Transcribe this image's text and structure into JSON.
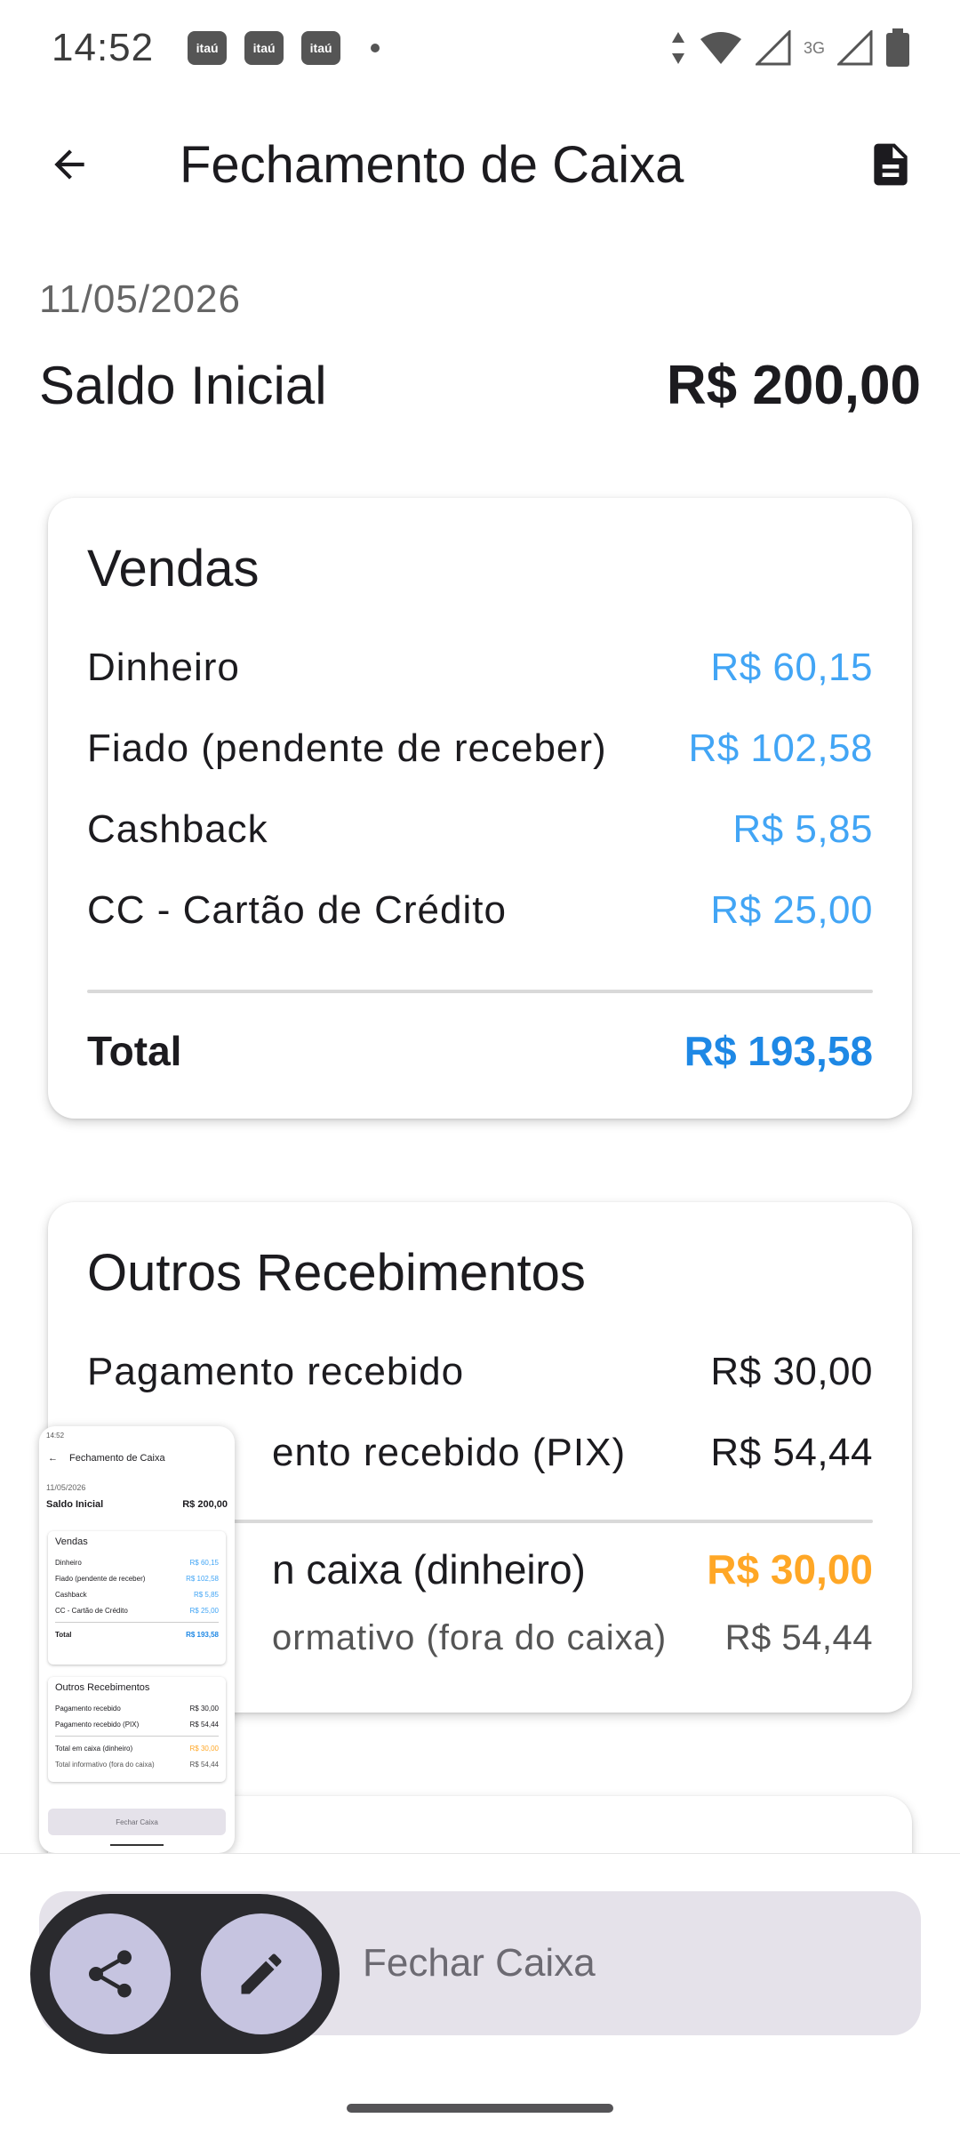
{
  "status_bar": {
    "time": "14:52",
    "notifications": [
      "itaú",
      "itaú",
      "itaú"
    ],
    "network_label": "3G",
    "icons": [
      "itau-app-icon",
      "dot-icon",
      "data-arrows-icon",
      "wifi-icon",
      "signal-icon",
      "battery-icon"
    ]
  },
  "app_bar": {
    "title": "Fechamento de Caixa",
    "back_icon": "arrow-left-icon",
    "action_icon": "document-icon"
  },
  "header": {
    "date": "11/05/2026",
    "saldo_label": "Saldo Inicial",
    "saldo_value": "R$ 200,00"
  },
  "vendas": {
    "title": "Vendas",
    "rows": [
      {
        "label": "Dinheiro",
        "value": "R$ 60,15"
      },
      {
        "label": "Fiado (pendente de receber)",
        "value": "R$ 102,58"
      },
      {
        "label": "Cashback",
        "value": "R$ 5,85"
      },
      {
        "label": "CC - Cartão de Crédito",
        "value": "R$ 25,00"
      }
    ],
    "total_label": "Total",
    "total_value": "R$ 193,58"
  },
  "outros": {
    "title": "Outros Recebimentos",
    "rows": [
      {
        "label": "Pagamento recebido",
        "value": "R$ 30,00"
      },
      {
        "label": "ento recebido (PIX)",
        "value": "R$ 54,44"
      }
    ],
    "total_caixa_label": "n caixa (dinheiro)",
    "total_caixa_value": "R$ 30,00",
    "informativo_label": "ormativo (fora do caixa)",
    "informativo_value": "R$ 54,44"
  },
  "thumbnail": {
    "status": "14:52",
    "title": "Fechamento de Caixa",
    "date": "11/05/2026",
    "saldo_label": "Saldo Inicial",
    "saldo_value": "R$ 200,00",
    "vendas_title": "Vendas",
    "vendas_rows": [
      {
        "label": "Dinheiro",
        "value": "R$ 60,15"
      },
      {
        "label": "Fiado (pendente de receber)",
        "value": "R$ 102,58"
      },
      {
        "label": "Cashback",
        "value": "R$ 5,85"
      },
      {
        "label": "CC - Cartão de Crédito",
        "value": "R$ 25,00"
      }
    ],
    "vendas_total_label": "Total",
    "vendas_total_value": "R$ 193,58",
    "outros_title": "Outros Recebimentos",
    "outros_rows": [
      {
        "label": "Pagamento recebido",
        "value": "R$ 30,00"
      },
      {
        "label": "Pagamento recebido (PIX)",
        "value": "R$ 54,44"
      }
    ],
    "outros_total_label": "Total em caixa (dinheiro)",
    "outros_total_value": "R$ 30,00",
    "outros_info_label": "Total informativo (fora do caixa)",
    "outros_info_value": "R$ 54,44",
    "button_label": "Fechar Caixa"
  },
  "bottom": {
    "fechar_label": "Fechar Caixa"
  },
  "floating_toolbar": {
    "share_icon": "share-icon",
    "edit_icon": "pencil-icon"
  },
  "colors": {
    "blue": "#42a5f5",
    "blue_strong": "#1e88e5",
    "orange": "#ffa726",
    "button_bg": "#e5e2ea",
    "toolbar_bg": "#2a2a2e",
    "toolbar_btn": "#c6c4e0"
  }
}
